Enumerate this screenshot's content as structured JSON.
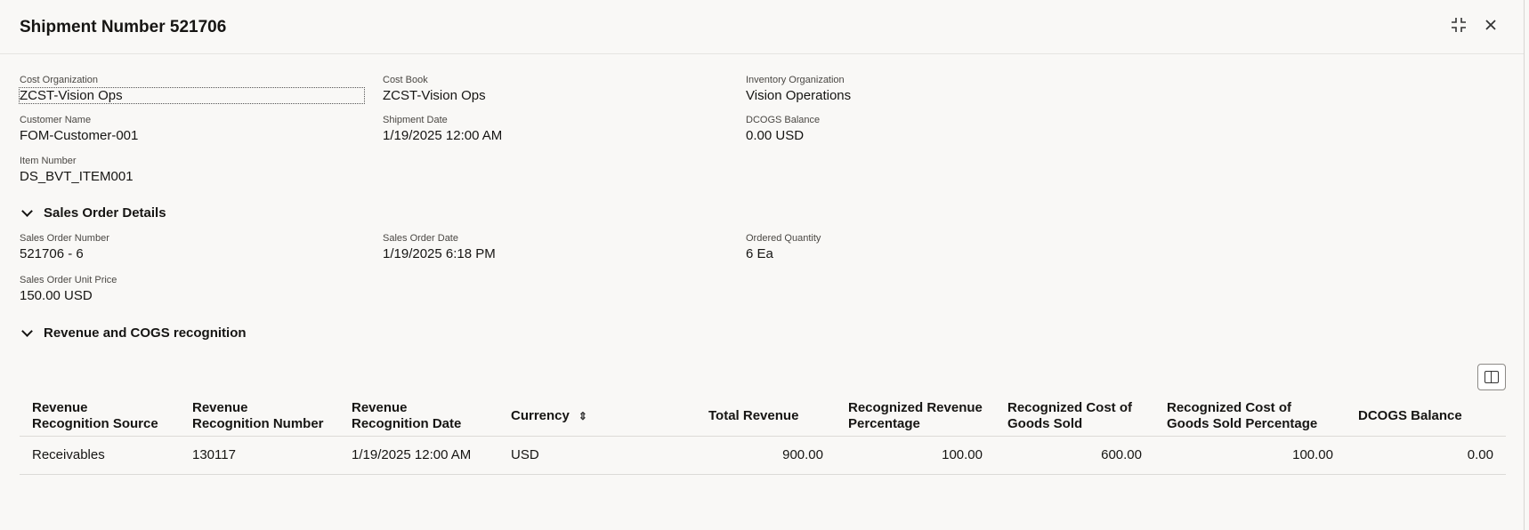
{
  "title": "Shipment Number 521706",
  "header_icons": [
    "collapse-icon",
    "close-icon"
  ],
  "fields": [
    {
      "label": "Cost Organization",
      "value": "ZCST-Vision Ops"
    },
    {
      "label": "Cost Book",
      "value": "ZCST-Vision Ops"
    },
    {
      "label": "Inventory Organization",
      "value": "Vision Operations"
    },
    {
      "label": "Customer Name",
      "value": "FOM-Customer-001"
    },
    {
      "label": "Shipment Date",
      "value": "1/19/2025 12:00 AM"
    },
    {
      "label": "DCOGS Balance",
      "value": "0.00 USD"
    },
    {
      "label": "Item Number",
      "value": "DS_BVT_ITEM001"
    }
  ],
  "sales_section": {
    "title": "Sales Order Details",
    "fields": [
      {
        "label": "Sales Order Number",
        "value": "521706 - 6"
      },
      {
        "label": "Sales Order Date",
        "value": "1/19/2025 6:18 PM"
      },
      {
        "label": "Ordered Quantity",
        "value": "6 Ea"
      },
      {
        "label": "Sales Order Unit Price",
        "value": "150.00 USD"
      }
    ]
  },
  "revenue_section": {
    "title": "Revenue and COGS recognition",
    "columns": [
      "Revenue Recognition Source",
      "Revenue Recognition Number",
      "Revenue Recognition Date",
      "Currency",
      "Total Revenue",
      "Recognized Revenue Percentage",
      "Recognized Cost of Goods Sold",
      "Recognized Cost of Goods Sold Percentage",
      "DCOGS Balance"
    ],
    "rows": [
      [
        "Receivables",
        "130117",
        "1/19/2025 12:00 AM",
        "USD",
        "900.00",
        "100.00",
        "600.00",
        "100.00",
        "0.00"
      ]
    ]
  }
}
